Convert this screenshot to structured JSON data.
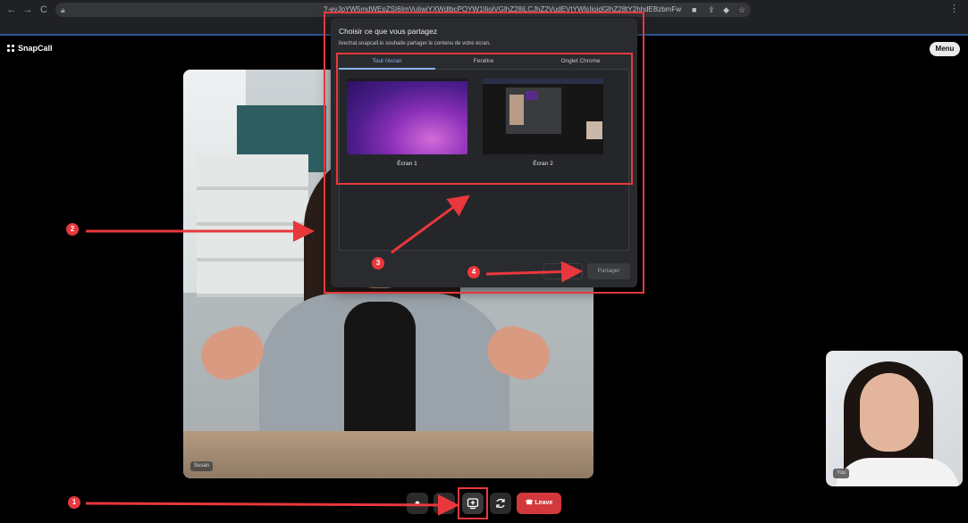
{
  "browser": {
    "back_icon": "←",
    "forward_icon": "→",
    "reload_icon": "C",
    "url": "?-eyJpYW5mdWEpZSI6ImVuIiwiYXWdlbcPOYW1lIjoiVGlhZ28iLCJhZ2VudEVtYWlsIjoidGlhZ28tY2hhdEBzbmFw...",
    "menu_icon": "⋮"
  },
  "app": {
    "logo": "SnapCall",
    "menu_label": "Menu",
    "main_participant": "Susan",
    "self_label": "You"
  },
  "controls": {
    "leave_label": "Leave"
  },
  "dialog": {
    "title": "Choisir ce que vous partagez",
    "subtitle": "livechat.snapcall.io souhaite partager le contenu de votre écran.",
    "tabs": [
      "Tout l'écran",
      "Fenêtre",
      "Onglet Chrome"
    ],
    "screens": [
      "Écran 1",
      "Écran 2"
    ],
    "share_label": "Partager"
  },
  "annotations": {
    "color": "#e8383d",
    "badges": [
      "1",
      "2",
      "3",
      "4"
    ]
  }
}
